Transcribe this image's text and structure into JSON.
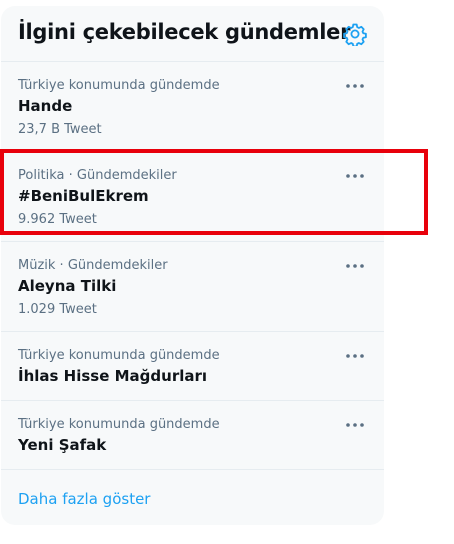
{
  "panel": {
    "title": "İlgini çekebilecek gündemler",
    "settings_icon": "gear-icon",
    "accent_color": "#1da1f2",
    "highlight_color": "#e8000b"
  },
  "trends": [
    {
      "meta": "Türkiye konumunda gündemde",
      "name": "Hande",
      "count": "23,7 B Tweet"
    },
    {
      "meta": "Politika · Gündemdekiler",
      "name": "#BeniBulEkrem",
      "count": "9.962 Tweet"
    },
    {
      "meta": "Müzik · Gündemdekiler",
      "name": "Aleyna Tilki",
      "count": "1.029 Tweet"
    },
    {
      "meta": "Türkiye konumunda gündemde",
      "name": "İhlas Hisse Mağdurları"
    },
    {
      "meta": "Türkiye konumunda gündemde",
      "name": "Yeni Şafak"
    }
  ],
  "show_more": "Daha fazla göster",
  "more_icon": "more-dots-icon"
}
